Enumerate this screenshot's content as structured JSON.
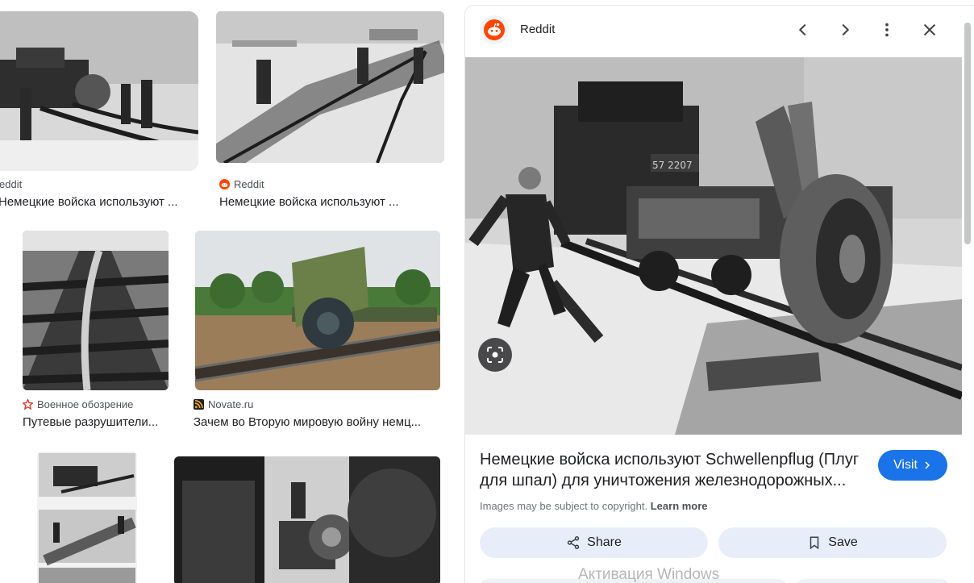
{
  "results": [
    {
      "source": "eddit",
      "title": "Немецкие войска используют ..."
    },
    {
      "source": "Reddit",
      "title": "Немецкие войска используют ..."
    },
    {
      "source": "Военное обозрение",
      "title": "Путевые разрушители..."
    },
    {
      "source": "Novate.ru",
      "title": "Зачем во Вторую мировую войну немц..."
    }
  ],
  "preview": {
    "site_name": "Reddit",
    "title": "Немецкие войска используют Schwellenpflug (Плуг для шпал) для уничтожения железнодорожных...",
    "visit_label": "Visit",
    "copyright_text": "Images may be subject to copyright.",
    "learn_more": "Learn more",
    "share_label": "Share",
    "save_label": "Save",
    "image_overlay_text": "57 2207"
  },
  "watermark": "Активация Windows",
  "icons": {
    "reddit": "reddit-icon",
    "prev": "chevron-left-icon",
    "next": "chevron-right-icon",
    "more": "more-vert-icon",
    "close": "close-icon",
    "lens": "lens-icon",
    "share": "share-icon",
    "save": "bookmark-icon"
  },
  "colors": {
    "accent": "#1a73e8",
    "reddit": "#ff4500",
    "action_bg": "#e8eef9",
    "voennoe": "#d93025",
    "novate": "#f9a825"
  }
}
